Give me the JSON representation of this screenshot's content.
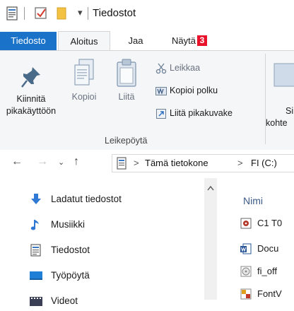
{
  "window": {
    "title": "Tiedostot"
  },
  "quick_access": {
    "dropdown_glyph": "▾"
  },
  "tabs": [
    {
      "label": "Tiedosto"
    },
    {
      "label": "Aloitus"
    },
    {
      "label": "Jaa"
    },
    {
      "label": "Näytä",
      "key_tip": "3"
    }
  ],
  "ribbon": {
    "pin": {
      "line1": "Kiinnitä",
      "line2": "pikakäyttöön"
    },
    "copy": {
      "label": "Kopioi"
    },
    "paste": {
      "label": "Liitä"
    },
    "cut": {
      "label": "Leikkaa"
    },
    "copy_path": {
      "label": "Kopioi polku"
    },
    "paste_shortcut": {
      "label": "Liitä pikakuvake"
    },
    "group_label": "Leikepöytä",
    "truncated_btn": {
      "line1": "Si",
      "line2": "kohte"
    }
  },
  "address": {
    "segments": [
      "Tämä tietokone",
      "FI (C:)"
    ],
    "separator": ">"
  },
  "nav_pane": {
    "items": [
      {
        "label": "Ladatut tiedostot",
        "icon": "download-arrow-icon"
      },
      {
        "label": "Musiikki",
        "icon": "music-note-icon"
      },
      {
        "label": "Tiedostot",
        "icon": "documents-icon"
      },
      {
        "label": "Työpöytä",
        "icon": "desktop-icon"
      },
      {
        "label": "Videot",
        "icon": "video-icon"
      }
    ]
  },
  "file_list": {
    "column_name": "Nimi",
    "rows": [
      {
        "name": "C1 T0",
        "icon": "media-file-icon"
      },
      {
        "name": "Docu",
        "icon": "word-document-icon"
      },
      {
        "name": "fi_off",
        "icon": "disc-image-icon"
      },
      {
        "name": "FontV",
        "icon": "font-file-icon"
      }
    ]
  },
  "colors": {
    "file_tab": "#1a73c9",
    "key_badge": "#e8122b",
    "ribbon_bg": "#f5f6f7"
  }
}
